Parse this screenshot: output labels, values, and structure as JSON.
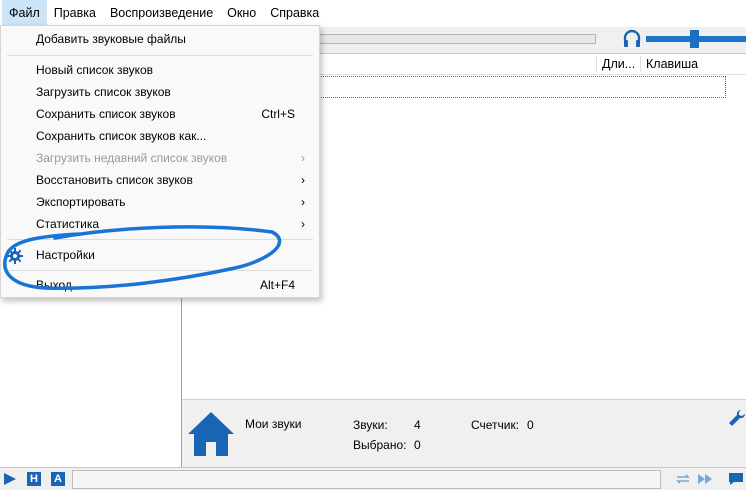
{
  "menubar": {
    "items": [
      "Файл",
      "Правка",
      "Воспроизведение",
      "Окно",
      "Справка"
    ]
  },
  "file_menu": {
    "add_sound_files": "Добавить звуковые файлы",
    "new_list": "Новый список звуков",
    "load_list": "Загрузить список звуков",
    "save_list": "Сохранить список звуков",
    "save_list_shortcut": "Ctrl+S",
    "save_list_as": "Сохранить список звуков как...",
    "load_recent": "Загрузить недавний список звуков",
    "restore_list": "Восстановить список звуков",
    "export": "Экспортировать",
    "statistics": "Статистика",
    "settings": "Настройки",
    "exit": "Выход",
    "exit_shortcut": "Alt+F4",
    "submenu_arrow": "›"
  },
  "list": {
    "columns": {
      "duration": "Дли...",
      "key": "Клавиша"
    }
  },
  "info": {
    "name": "Мои звуки",
    "sounds_label": "Звуки:",
    "sounds_value": "4",
    "counter_label": "Счетчик:",
    "counter_value": "0",
    "selected_label": "Выбрано:",
    "selected_value": "0"
  },
  "statusbar": {
    "btn_h": "H",
    "btn_a": "A"
  },
  "colors": {
    "accent": "#1a64b4",
    "annotation": "#1a73d6"
  }
}
